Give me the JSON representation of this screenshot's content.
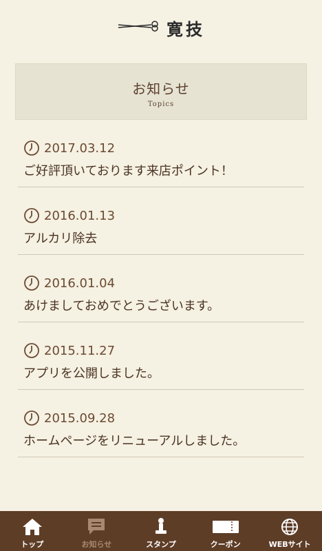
{
  "app": {
    "logo_text": "寛技"
  },
  "section": {
    "title": "お知らせ",
    "subtitle": "Topics"
  },
  "topics": [
    {
      "date": "2017.03.12",
      "title": "ご好評頂いております来店ポイント！"
    },
    {
      "date": "2016.01.13",
      "title": "アルカリ除去"
    },
    {
      "date": "2016.01.04",
      "title": "あけましておめでとうございます。"
    },
    {
      "date": "2015.11.27",
      "title": "アプリを公開しました。"
    },
    {
      "date": "2015.09.28",
      "title": "ホームページをリニューアルしました。"
    }
  ],
  "tabbar": {
    "items": [
      {
        "label": "トップ",
        "icon": "home-icon",
        "active": false
      },
      {
        "label": "お知らせ",
        "icon": "message-icon",
        "active": true
      },
      {
        "label": "スタンプ",
        "icon": "stamp-icon",
        "active": false
      },
      {
        "label": "クーポン",
        "icon": "ticket-icon",
        "active": false
      },
      {
        "label": "WEBサイト",
        "icon": "globe-icon",
        "active": false
      }
    ]
  },
  "colors": {
    "background": "#f5f1e3",
    "tabbar": "#5e3d27",
    "accent_text": "#5b3f2c",
    "active_tab": "#a88870"
  }
}
